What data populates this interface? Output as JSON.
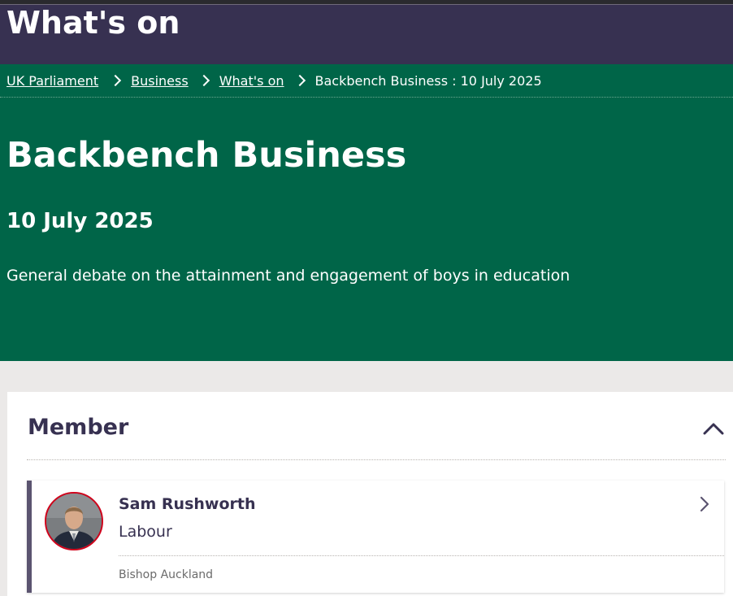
{
  "header": {
    "title": "What's on"
  },
  "breadcrumb": {
    "items": [
      "UK Parliament",
      "Business",
      "What's on"
    ],
    "current": "Backbench Business : 10 July 2025"
  },
  "page": {
    "title": "Backbench Business",
    "date": "10 July 2025",
    "description": "General debate on the attainment and engagement of boys in education"
  },
  "members_section": {
    "title": "Member",
    "member": {
      "name": "Sam Rushworth",
      "party": "Labour",
      "constituency": "Bishop Auckland",
      "party_color": "#d0021b"
    }
  },
  "colors": {
    "header_bg": "#373151",
    "hero_bg": "#006548",
    "page_bg": "#ebe9e8",
    "accent_text": "#373151"
  },
  "icons": {
    "breadcrumb_separator": "chevron-right-icon",
    "collapse": "chevron-up-icon",
    "member_link": "chevron-right-icon"
  }
}
